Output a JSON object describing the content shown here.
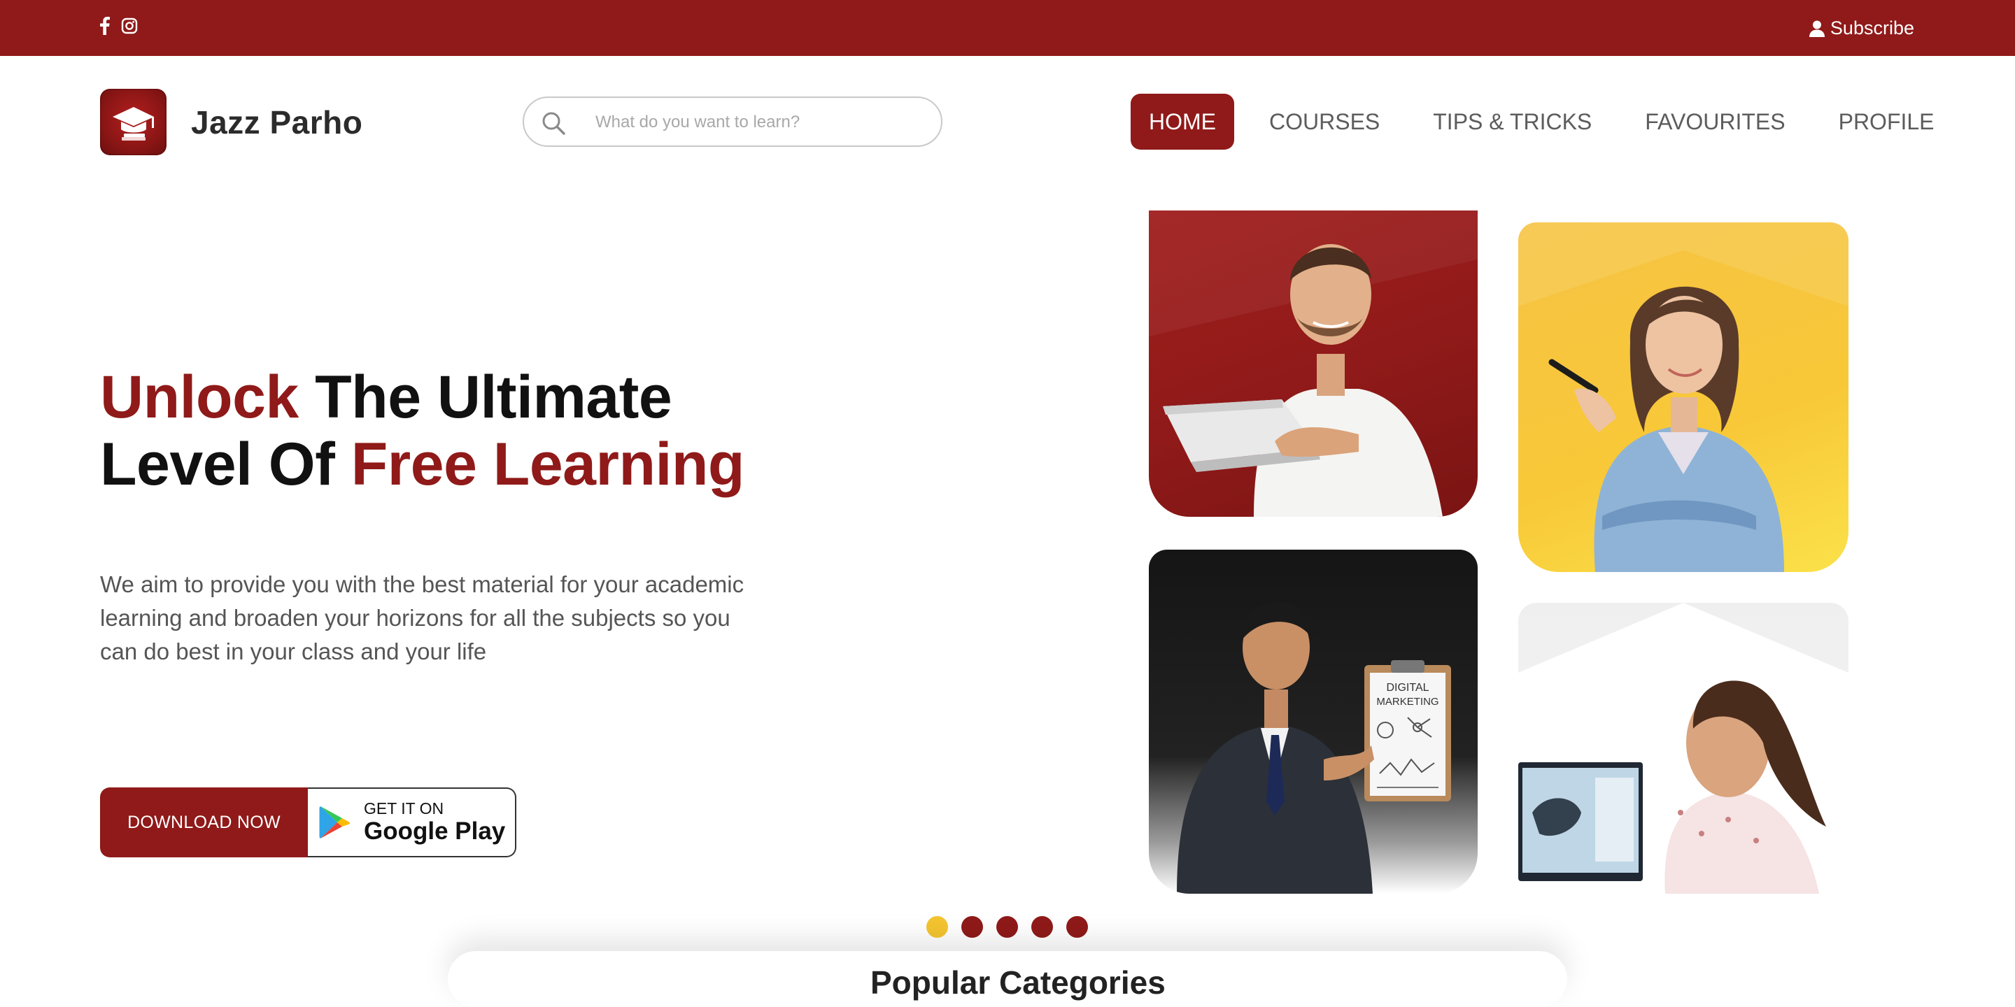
{
  "topbar": {
    "social_icons": [
      "facebook-icon",
      "instagram-icon"
    ],
    "subscribe_label": "Subscribe",
    "background_color": "#8f1a19"
  },
  "header": {
    "brand_name": "Jazz Parho",
    "logo_icon": "graduation-cap-icon",
    "search_placeholder": "What do you want to learn?",
    "nav": [
      {
        "label": "HOME",
        "active": true
      },
      {
        "label": "COURSES",
        "active": false
      },
      {
        "label": "TIPS & TRICKS",
        "active": false
      },
      {
        "label": "FAVOURITES",
        "active": false
      },
      {
        "label": "PROFILE",
        "active": false
      }
    ]
  },
  "hero": {
    "headline_part1": "Unlock",
    "headline_part2": " The Ultimate",
    "headline_part3": "Level Of ",
    "headline_part4": "Free Learning",
    "description": "We aim to provide you with the best material for your academic learning and broaden your horizons for all the subjects so you can do best in your class and your life",
    "download_label": "DOWNLOAD NOW",
    "gplay_small": "GET IT ON",
    "gplay_big": "Google Play",
    "board_line1": "DIGITAL",
    "board_line2": "MARKETING"
  },
  "carousel": {
    "dot_count": 5,
    "active_index": 0
  },
  "section": {
    "title": "Popular Categories"
  },
  "colors": {
    "brand_red": "#8f1a19",
    "accent_yellow": "#f4c430"
  }
}
